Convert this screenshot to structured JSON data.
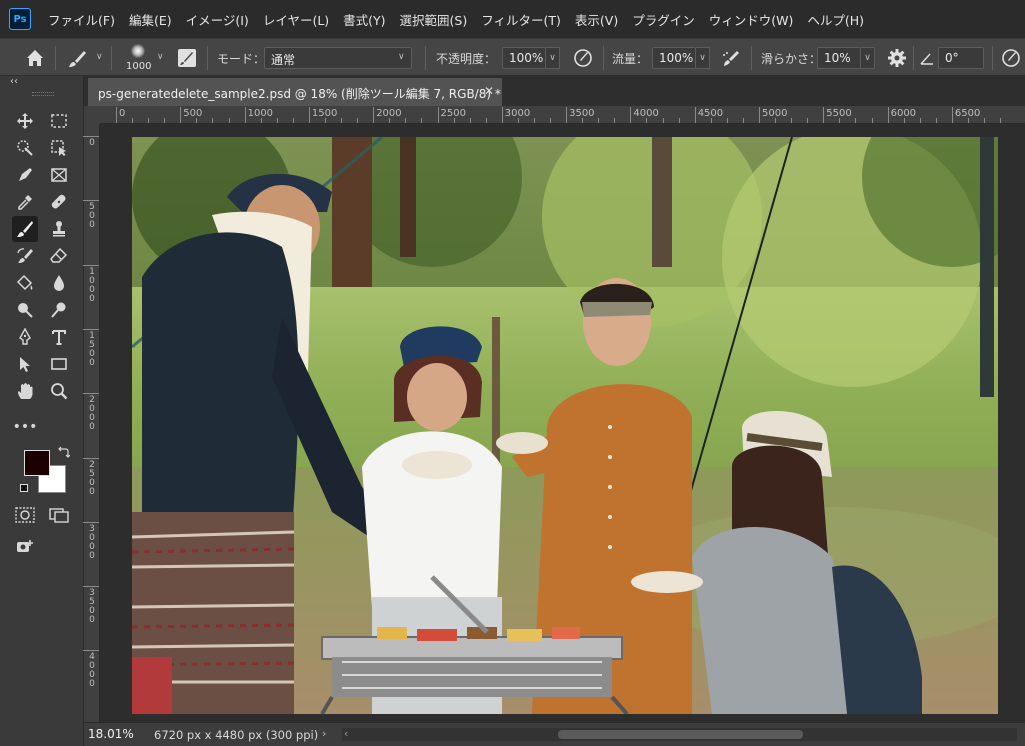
{
  "app": {
    "logo_text": "Ps"
  },
  "menu": [
    "ファイル(F)",
    "編集(E)",
    "イメージ(I)",
    "レイヤー(L)",
    "書式(Y)",
    "選択範囲(S)",
    "フィルター(T)",
    "表示(V)",
    "プラグイン",
    "ウィンドウ(W)",
    "ヘルプ(H)"
  ],
  "options": {
    "brush_size": "1000",
    "mode_label": "モード：",
    "mode_value": "通常",
    "opacity_label": "不透明度：",
    "opacity_value": "100%",
    "flow_label": "流量：",
    "flow_value": "100%",
    "smoothing_label": "滑らかさ：",
    "smoothing_value": "10%",
    "angle_value": "0°"
  },
  "document": {
    "tab_title": "ps-generatedelete_sample2.psd @ 18% (削除ツール編集 7, RGB/8) *",
    "zoom": "18.01%",
    "info": "6720 px x 4480 px (300 ppi)"
  },
  "ruler": {
    "h_labels": [
      "0",
      "500",
      "1000",
      "1500",
      "2000",
      "2500",
      "3000",
      "3500",
      "4000",
      "4500",
      "5000",
      "5500",
      "6000",
      "6500"
    ],
    "v_labels": [
      "0",
      "500",
      "1000",
      "1500",
      "2000",
      "2500",
      "3000",
      "3500",
      "4000"
    ]
  },
  "colors": {
    "foreground": "#1a0000",
    "background": "#ffffff",
    "ui_dark": "#2b2b2b",
    "ui_panel": "#3a3a3a",
    "ps_blue": "#31a8ff"
  },
  "icons": [
    "home-icon",
    "brush-icon",
    "brush-settings-icon",
    "airbrush-icon",
    "pressure-icon",
    "gear-icon",
    "angle-icon",
    "symmetry-icon"
  ]
}
